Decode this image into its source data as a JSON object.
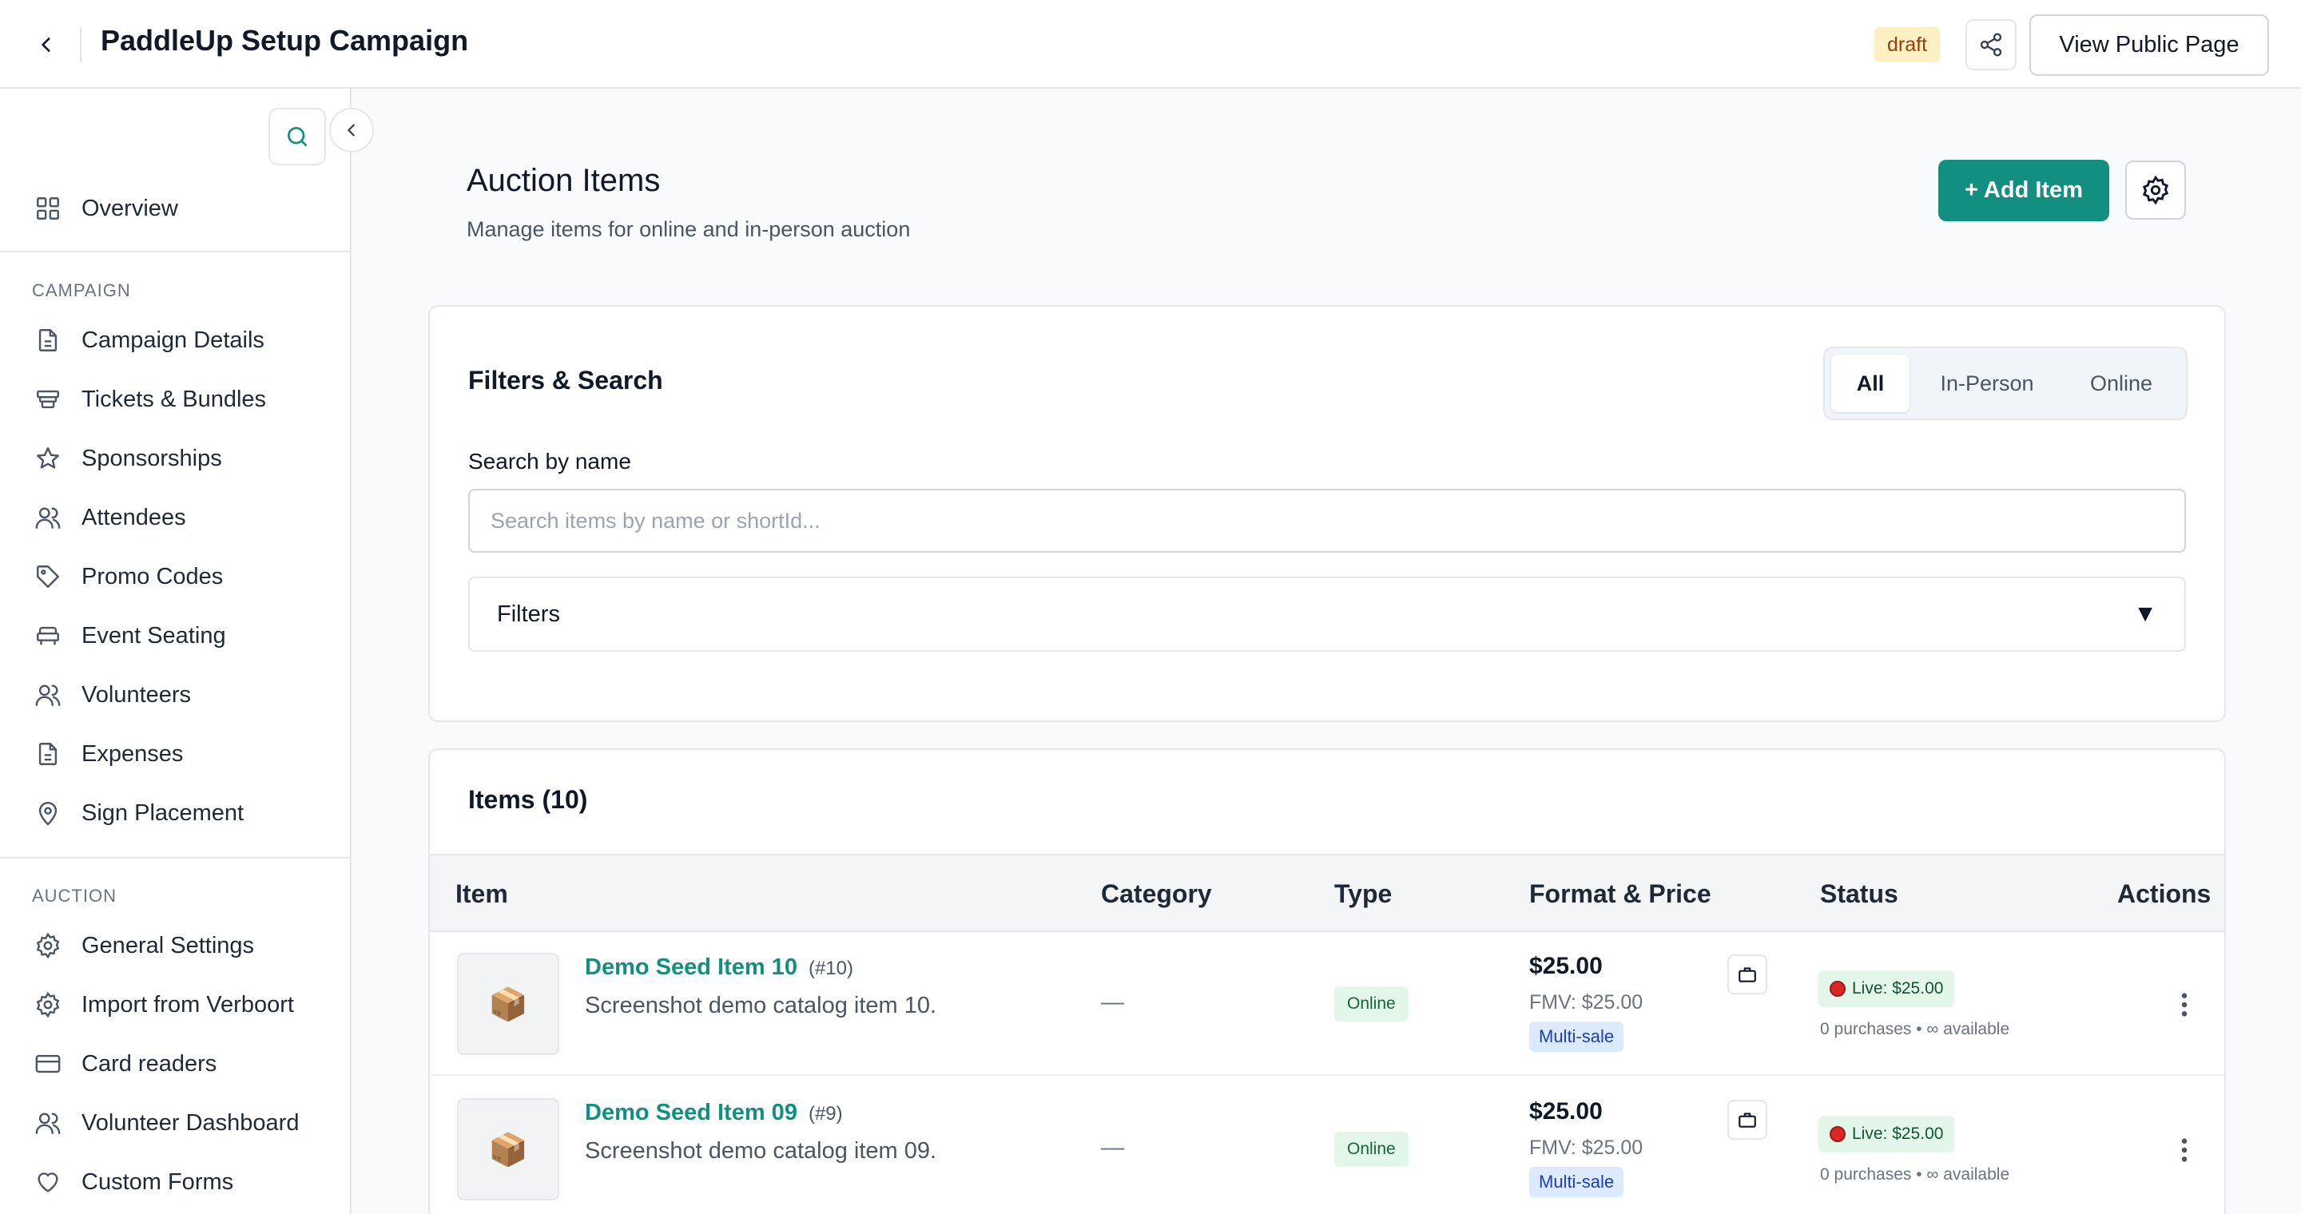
{
  "header": {
    "title": "PaddleUp Setup Campaign",
    "status_badge": "draft",
    "view_public_label": "View Public Page"
  },
  "sidebar": {
    "overview": "Overview",
    "sections": [
      {
        "title": "CAMPAIGN",
        "items": [
          {
            "label": "Campaign Details",
            "icon": "document-icon"
          },
          {
            "label": "Tickets & Bundles",
            "icon": "ticket-icon"
          },
          {
            "label": "Sponsorships",
            "icon": "star-icon"
          },
          {
            "label": "Attendees",
            "icon": "users-icon"
          },
          {
            "label": "Promo Codes",
            "icon": "tag-icon"
          },
          {
            "label": "Event Seating",
            "icon": "armchair-icon"
          },
          {
            "label": "Volunteers",
            "icon": "users-icon"
          },
          {
            "label": "Expenses",
            "icon": "document-icon"
          },
          {
            "label": "Sign Placement",
            "icon": "map-pin-icon"
          }
        ]
      },
      {
        "title": "AUCTION",
        "items": [
          {
            "label": "General Settings",
            "icon": "gear-icon"
          },
          {
            "label": "Import from Verboort",
            "icon": "gear-icon"
          },
          {
            "label": "Card readers",
            "icon": "credit-card-icon"
          },
          {
            "label": "Volunteer Dashboard",
            "icon": "users-icon"
          },
          {
            "label": "Custom Forms",
            "icon": "heart-icon"
          }
        ]
      }
    ]
  },
  "main": {
    "title": "Auction Items",
    "subtitle": "Manage items for online and in-person auction",
    "add_item_label": "+ Add Item"
  },
  "filters": {
    "title": "Filters & Search",
    "segments": [
      "All",
      "In-Person",
      "Online"
    ],
    "active_segment": "All",
    "search_label": "Search by name",
    "search_placeholder": "Search items by name or shortId...",
    "search_value": "",
    "filters_label": "Filters",
    "caret": "▼"
  },
  "items": {
    "title": "Items (10)",
    "columns": [
      "Item",
      "Category",
      "Type",
      "Format & Price",
      "Status",
      "Actions"
    ],
    "rows": [
      {
        "thumb": "📦",
        "name": "Demo Seed Item 10",
        "short_id": "(#10)",
        "description": "Screenshot demo catalog item 10.",
        "category": "—",
        "type": "Online",
        "price": "$25.00",
        "fmv": "FMV: $25.00",
        "format": "Multi-sale",
        "status": "Live: $25.00",
        "purchases": "0 purchases • ∞ available"
      },
      {
        "thumb": "📦",
        "name": "Demo Seed Item 09",
        "short_id": "(#9)",
        "description": "Screenshot demo catalog item 09.",
        "category": "—",
        "type": "Online",
        "price": "$25.00",
        "fmv": "FMV: $25.00",
        "format": "Multi-sale",
        "status": "Live: $25.00",
        "purchases": "0 purchases • ∞ available"
      }
    ]
  },
  "colors": {
    "accent": "#138f80",
    "draft_bg": "#fdf0c2",
    "online_bg": "#e3f6ea",
    "multi_sale_bg": "#dbeafe",
    "live_dot": "#dc2626"
  }
}
